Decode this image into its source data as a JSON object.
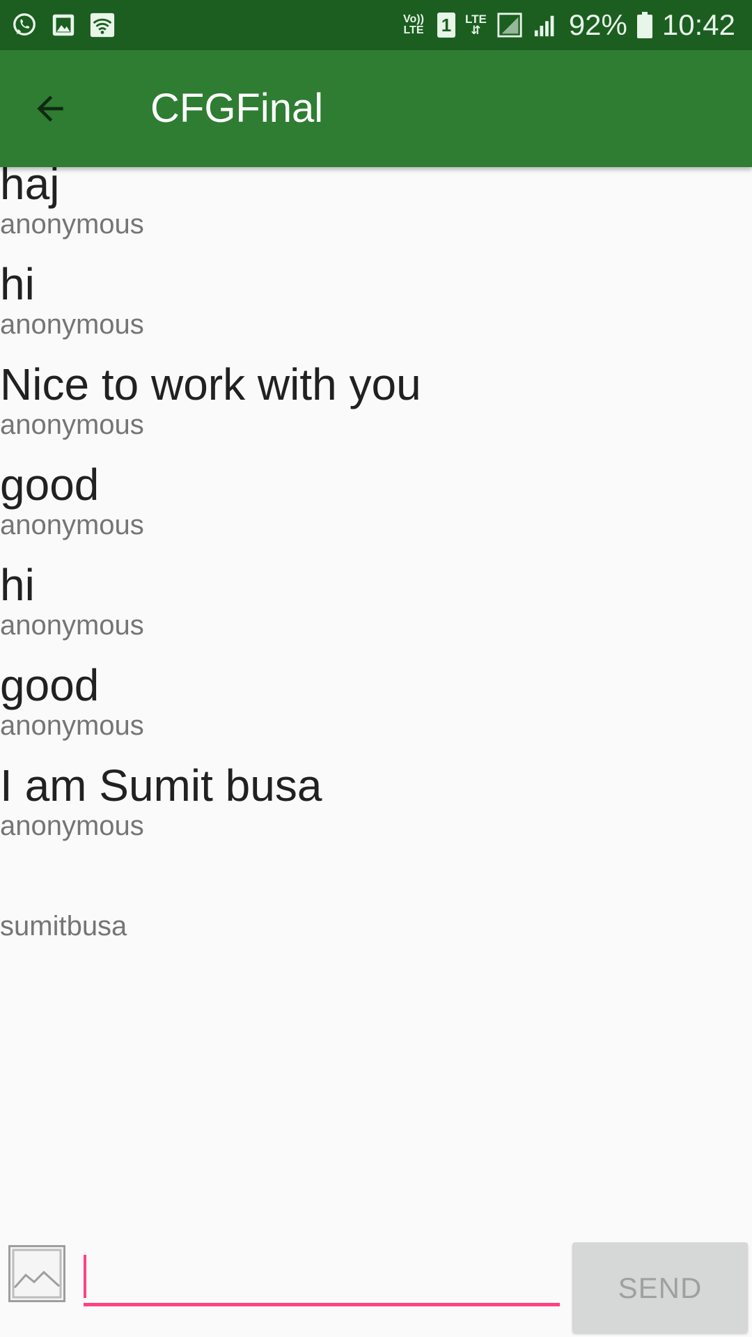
{
  "status_bar": {
    "left_icons": [
      "whatsapp-icon",
      "gallery-icon",
      "wifi-icon"
    ],
    "volte_line1": "Vo))",
    "volte_line2": "LTE",
    "sim_number": "1",
    "network_type": "LTE",
    "battery_percent": "92%",
    "time": "10:42",
    "colors": {
      "status_bar_bg": "#1b5e20",
      "icon_color": "#e8f5e9"
    }
  },
  "app_bar": {
    "title": "CFGFinal",
    "back_icon": "arrow-left-icon",
    "background": "#2e7d32"
  },
  "messages": [
    {
      "text": "haj",
      "author": "anonymous"
    },
    {
      "text": "hi",
      "author": "anonymous"
    },
    {
      "text": "Nice to work with you",
      "author": "anonymous"
    },
    {
      "text": "good",
      "author": "anonymous"
    },
    {
      "text": "hi",
      "author": "anonymous"
    },
    {
      "text": "good",
      "author": "anonymous"
    },
    {
      "text": "I am Sumit busa",
      "author": "anonymous"
    },
    {
      "text": "",
      "author": "sumitbusa"
    }
  ],
  "composer": {
    "photo_icon": "image-picker-icon",
    "input_value": "",
    "input_placeholder": "",
    "send_label": "SEND",
    "accent_color": "#ff4081"
  }
}
